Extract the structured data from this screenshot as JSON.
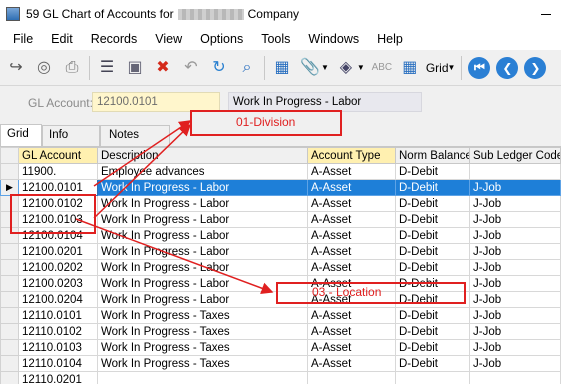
{
  "window": {
    "title_prefix": "59 GL Chart of Accounts for",
    "title_suffix": "Company"
  },
  "menu": [
    "File",
    "Edit",
    "Records",
    "View",
    "Options",
    "Tools",
    "Windows",
    "Help"
  ],
  "toolbar": {
    "grid_label": "Grid"
  },
  "account": {
    "label": "GL Account:",
    "value": "12100.0101",
    "description": "Work In Progress - Labor"
  },
  "tabs": [
    "Grid",
    "Info",
    "Notes"
  ],
  "grid": {
    "columns": [
      "GL Account",
      "Description",
      "Account Type",
      "Norm Balance",
      "Sub Ledger Code"
    ],
    "rows": [
      [
        "11900.",
        "Employee advances",
        "A-Asset",
        "D-Debit",
        ""
      ],
      [
        "12100.0101",
        "Work In Progress - Labor",
        "A-Asset",
        "D-Debit",
        "J-Job"
      ],
      [
        "12100.0102",
        "Work In Progress - Labor",
        "A-Asset",
        "D-Debit",
        "J-Job"
      ],
      [
        "12100.0103",
        "Work In Progress - Labor",
        "A-Asset",
        "D-Debit",
        "J-Job"
      ],
      [
        "12100.0104",
        "Work In Progress - Labor",
        "A-Asset",
        "D-Debit",
        "J-Job"
      ],
      [
        "12100.0201",
        "Work In Progress - Labor",
        "A-Asset",
        "D-Debit",
        "J-Job"
      ],
      [
        "12100.0202",
        "Work In Progress - Labor",
        "A-Asset",
        "D-Debit",
        "J-Job"
      ],
      [
        "12100.0203",
        "Work In Progress - Labor",
        "A-Asset",
        "D-Debit",
        "J-Job"
      ],
      [
        "12100.0204",
        "Work In Progress - Labor",
        "A-Asset",
        "D-Debit",
        "J-Job"
      ],
      [
        "12110.0101",
        "Work In Progress - Taxes",
        "A-Asset",
        "D-Debit",
        "J-Job"
      ],
      [
        "12110.0102",
        "Work In Progress - Taxes",
        "A-Asset",
        "D-Debit",
        "J-Job"
      ],
      [
        "12110.0103",
        "Work In Progress - Taxes",
        "A-Asset",
        "D-Debit",
        "J-Job"
      ],
      [
        "12110.0104",
        "Work In Progress - Taxes",
        "A-Asset",
        "D-Debit",
        "J-Job"
      ],
      [
        "12110.0201",
        "",
        "",
        "",
        ""
      ]
    ],
    "selected_row": 1
  },
  "annotations": {
    "division": "01-Division",
    "location": "03 - Location"
  },
  "colors": {
    "selection": "#1e7fd8",
    "annotation": "#e02020",
    "yellow_header": "#fff0b0",
    "input_bg": "#fff6cc"
  }
}
